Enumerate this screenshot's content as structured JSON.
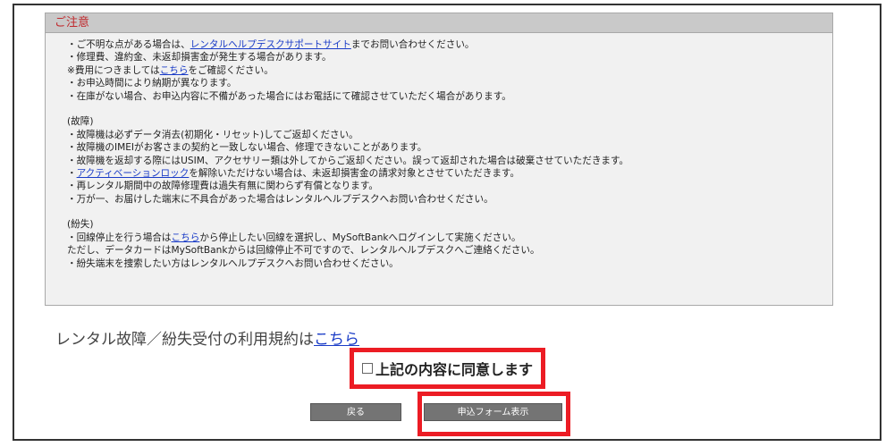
{
  "notice": {
    "header": "ご注意",
    "intro": [
      {
        "before": "・ご不明な点がある場合は、",
        "link": "レンタルヘルプデスクサポートサイト",
        "after": "までお問い合わせください。"
      },
      {
        "before": "・修理費、違約金、未返却損害金が発生する場合があります。",
        "link": "",
        "after": ""
      },
      {
        "before": "※費用につきましては",
        "link": "こちら",
        "after": "をご確認ください。"
      },
      {
        "before": "・お申込時間により納期が異なります。",
        "link": "",
        "after": ""
      },
      {
        "before": "・在庫がない場合、お申込内容に不備があった場合にはお電話にて確認させていただく場合があります。",
        "link": "",
        "after": ""
      }
    ],
    "breakdown_title": "(故障)",
    "breakdown": [
      {
        "before": "・故障機は必ずデータ消去(初期化・リセット)してご返却ください。",
        "link": "",
        "after": ""
      },
      {
        "before": "・故障機のIMEIがお客さまの契約と一致しない場合、修理できないことがあります。",
        "link": "",
        "after": ""
      },
      {
        "before": "・故障機を返却する際にはUSIM、アクセサリー類は外してからご返却ください。誤って返却された場合は破棄させていただきます。",
        "link": "",
        "after": ""
      },
      {
        "before": "・",
        "link": "アクティベーションロック",
        "after": "を解除いただけない場合は、未返却損害金の請求対象とさせていただきます。"
      },
      {
        "before": "・再レンタル期間中の故障修理費は過失有無に関わらず有償となります。",
        "link": "",
        "after": ""
      },
      {
        "before": "・万が一、お届けした端末に不具合があった場合はレンタルヘルプデスクへお問い合わせください。",
        "link": "",
        "after": ""
      }
    ],
    "loss_title": "(紛失)",
    "loss": [
      {
        "before": "・回線停止を行う場合は",
        "link": "こちら",
        "after": "から停止したい回線を選択し、MySoftBankへログインして実施ください。"
      },
      {
        "before": "ただし、データカードはMySoftBankからは回線停止不可ですので、レンタルヘルプデスクへご連絡ください。",
        "link": "",
        "after": ""
      },
      {
        "before": "・紛失端末を捜索したい方はレンタルヘルプデスクへお問い合わせください。",
        "link": "",
        "after": ""
      }
    ]
  },
  "terms": {
    "text": "レンタル故障／紛失受付の利用規約は",
    "link": "こちら"
  },
  "agree": {
    "label": "上記の内容に同意します",
    "checked": false
  },
  "buttons": {
    "back": "戻る",
    "apply": "申込フォーム表示"
  },
  "colors": {
    "accent_red": "#ec1c24",
    "link_blue": "#1a3cc7",
    "button_gray": "#747474"
  }
}
